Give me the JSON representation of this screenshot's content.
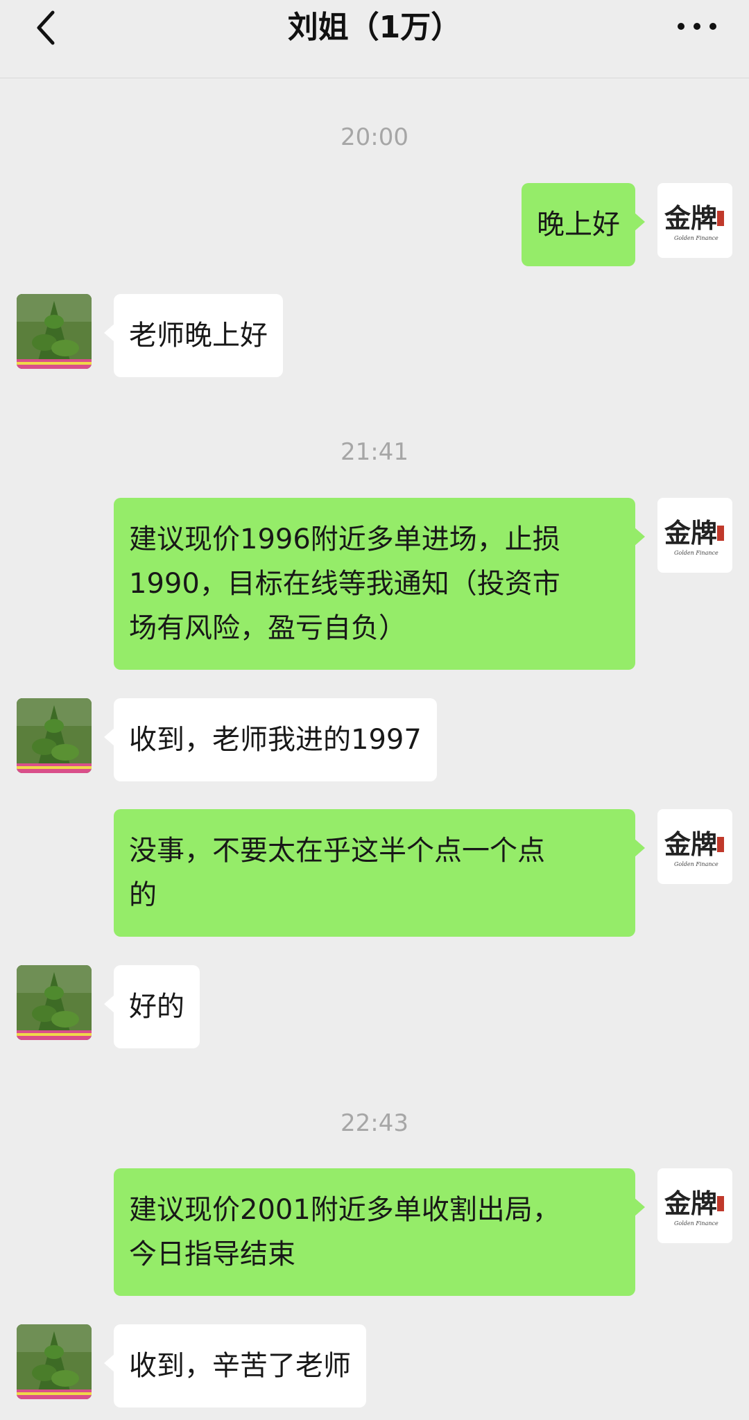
{
  "header": {
    "title": "刘姐（1万）",
    "back_icon": "chevron-left-icon",
    "more_icon": "more-dots-icon"
  },
  "colors": {
    "background": "#ededed",
    "my_bubble": "#95ec69",
    "other_bubble": "#ffffff",
    "timestamp": "#a6a6a6"
  },
  "logo": {
    "text": "金牌",
    "subtext": "Golden Finance"
  },
  "messages": [
    {
      "type": "time",
      "text": "20:00"
    },
    {
      "type": "msg",
      "sender": "me",
      "text": "晚上好"
    },
    {
      "type": "msg",
      "sender": "other",
      "text": "老师晚上好"
    },
    {
      "type": "time",
      "text": "21:41"
    },
    {
      "type": "msg",
      "sender": "me",
      "lines": [
        "建议现价1996附近多单进场，止损",
        "1990，目标在线等我通知（投资市",
        "场有风险，盈亏自负）"
      ]
    },
    {
      "type": "msg",
      "sender": "other",
      "text": "收到，老师我进的1997"
    },
    {
      "type": "msg",
      "sender": "me",
      "lines": [
        "没事，不要太在乎这半个点一个点",
        "的"
      ]
    },
    {
      "type": "msg",
      "sender": "other",
      "text": "好的"
    },
    {
      "type": "time",
      "text": "22:43"
    },
    {
      "type": "msg",
      "sender": "me",
      "lines": [
        "建议现价2001附近多单收割出局，",
        "今日指导结束"
      ]
    },
    {
      "type": "msg",
      "sender": "other",
      "text": "收到，辛苦了老师"
    }
  ]
}
